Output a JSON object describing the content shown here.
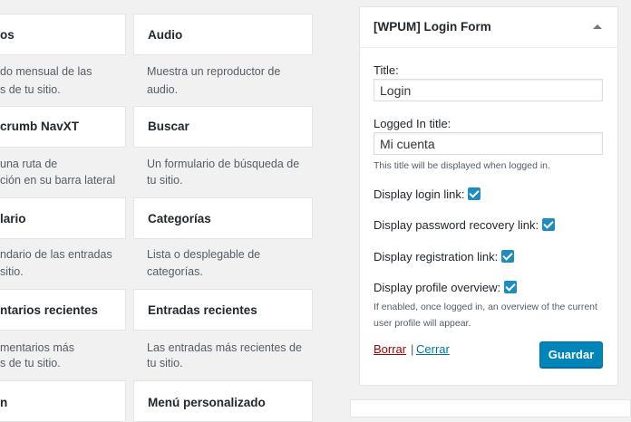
{
  "widgets_left": [
    {
      "title": "os",
      "desc": [
        "do mensual de las",
        "s de tu sitio."
      ]
    },
    {
      "title": "crumb NavXT",
      "desc": [
        "una ruta de",
        "ción en su barra lateral"
      ]
    },
    {
      "title": "lario",
      "desc": [
        "ndario de las entradas",
        "sitio."
      ]
    },
    {
      "title": "ntarios recientes",
      "desc": [
        "mentarios más",
        "s de tu sitio."
      ]
    },
    {
      "title": "n",
      "desc": []
    }
  ],
  "widgets_right": [
    {
      "title": "Audio",
      "desc": [
        "Muestra un reproductor de",
        "audio."
      ]
    },
    {
      "title": "Buscar",
      "desc": [
        "Un formulario de búsqueda de",
        "tu sitio."
      ]
    },
    {
      "title": "Categorías",
      "desc": [
        "Lista o desplegable de",
        "categorías."
      ]
    },
    {
      "title": "Entradas recientes",
      "desc": [
        "Las entradas más recientes de",
        "tu sitio."
      ]
    },
    {
      "title": "Menú personalizado",
      "desc": []
    }
  ],
  "panel": {
    "title": "[WPUM] Login Form",
    "title_label": "Title:",
    "title_value": "Login",
    "logged_label": "Logged In title:",
    "logged_value": "Mi cuenta",
    "logged_hint": "This title will be displayed when logged in.",
    "opt_login": "Display login link:",
    "opt_recovery": "Display password recovery link:",
    "opt_registration": "Display registration link:",
    "opt_profile": "Display profile overview:",
    "profile_hint_1": "If enabled, once logged in, an overview of the current",
    "profile_hint_2": "user profile will appear.",
    "delete_label": "Borrar",
    "separator": "|",
    "close_label": "Cerrar",
    "save_label": "Guardar"
  },
  "colors": {
    "accent": "#0085ba",
    "checkbox": "#1e8cbe",
    "delete": "#aa0000",
    "link": "#0073aa"
  }
}
